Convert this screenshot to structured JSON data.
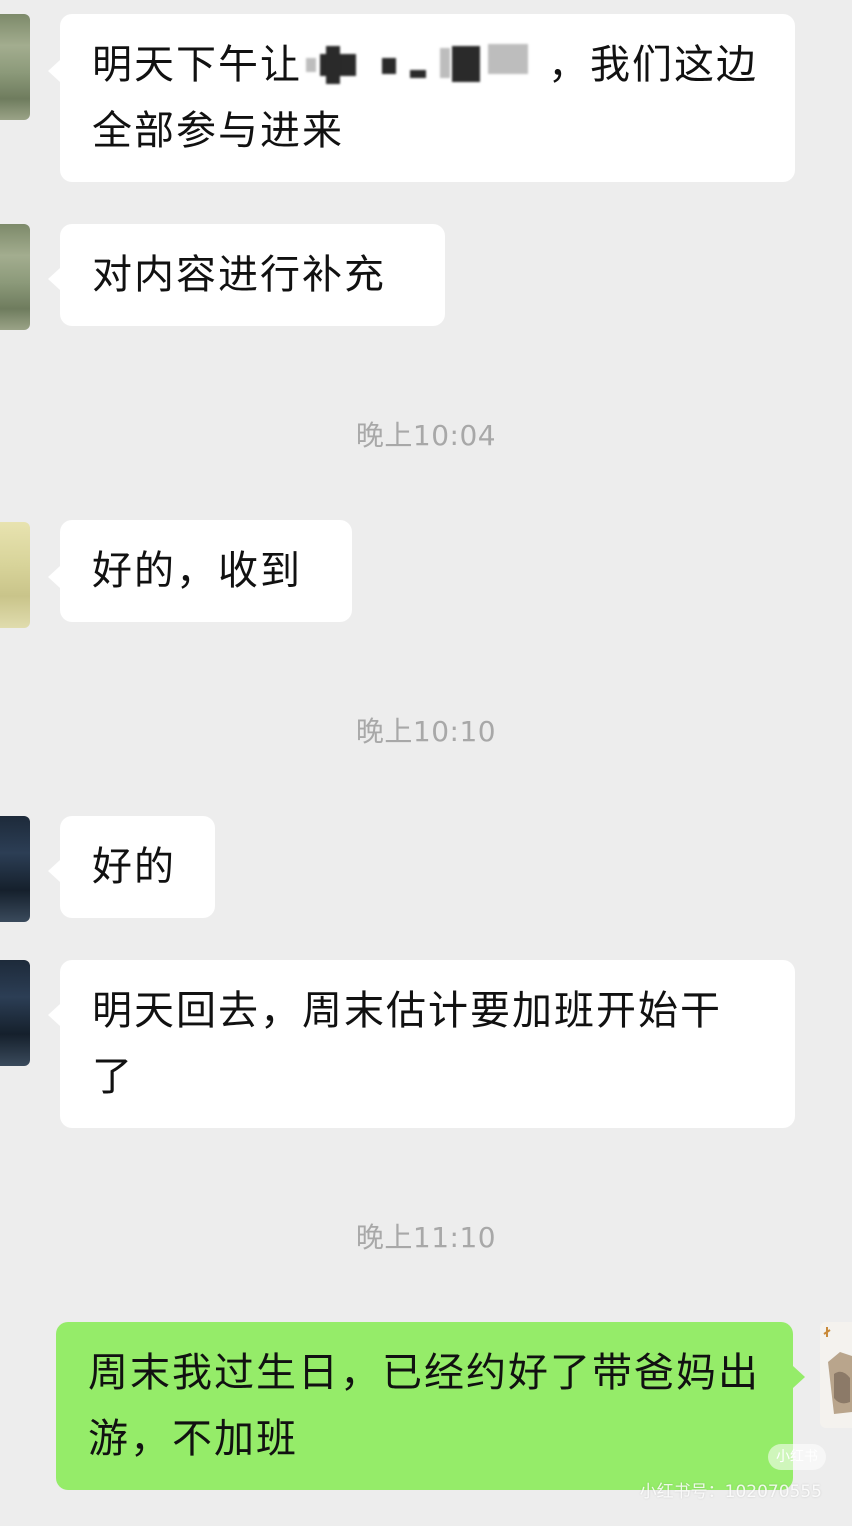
{
  "messages": [
    {
      "text_before": "明天下午让",
      "text_after": "，我们这边全部参与进来"
    },
    {
      "text": "对内容进行补充"
    },
    {
      "time": "晚上10:04"
    },
    {
      "text": "好的，收到"
    },
    {
      "time": "晚上10:10"
    },
    {
      "text": "好的"
    },
    {
      "text": "明天回去，周末估计要加班开始干了"
    },
    {
      "time": "晚上11:10"
    },
    {
      "text": "周末我过生日，已经约好了带爸妈出游，不加班"
    }
  ],
  "watermark": {
    "logo_text": "小红书",
    "text": "小红书号：102070555"
  },
  "colors": {
    "background": "#ededed",
    "incoming_bubble": "#ffffff",
    "outgoing_bubble": "#95ec69",
    "timestamp": "#a8a8a8"
  }
}
